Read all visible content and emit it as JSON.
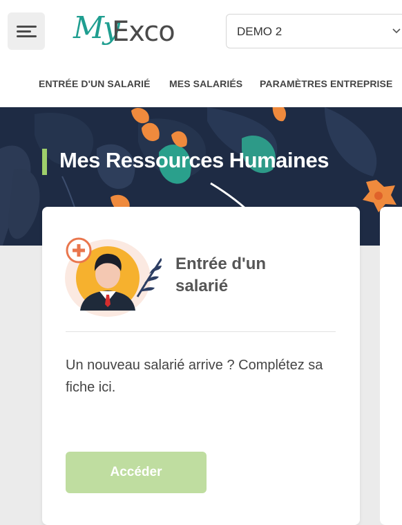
{
  "header": {
    "logo_my": "My",
    "logo_exco": "Exco",
    "company_select": {
      "value": "DEMO 2"
    }
  },
  "nav": {
    "items": [
      {
        "label": "ENTRÉE D'UN SALARIÉ"
      },
      {
        "label": "MES SALARIÉS"
      },
      {
        "label": "PARAMÈTRES ENTREPRISE"
      }
    ]
  },
  "page": {
    "title": "Mes Ressources Humaines"
  },
  "card": {
    "title": "Entrée d'un salarié",
    "description": "Un nouveau salarié arrive ? Complétez sa fiche ici.",
    "button_label": "Accéder"
  },
  "colors": {
    "accent_green": "#9ecf6b",
    "button_green": "#bfdda0",
    "banner_navy": "#1e2b44",
    "logo_teal": "#1f9e90"
  },
  "icons": [
    "menu-icon",
    "chevron-down-icon",
    "add-user-icon"
  ]
}
